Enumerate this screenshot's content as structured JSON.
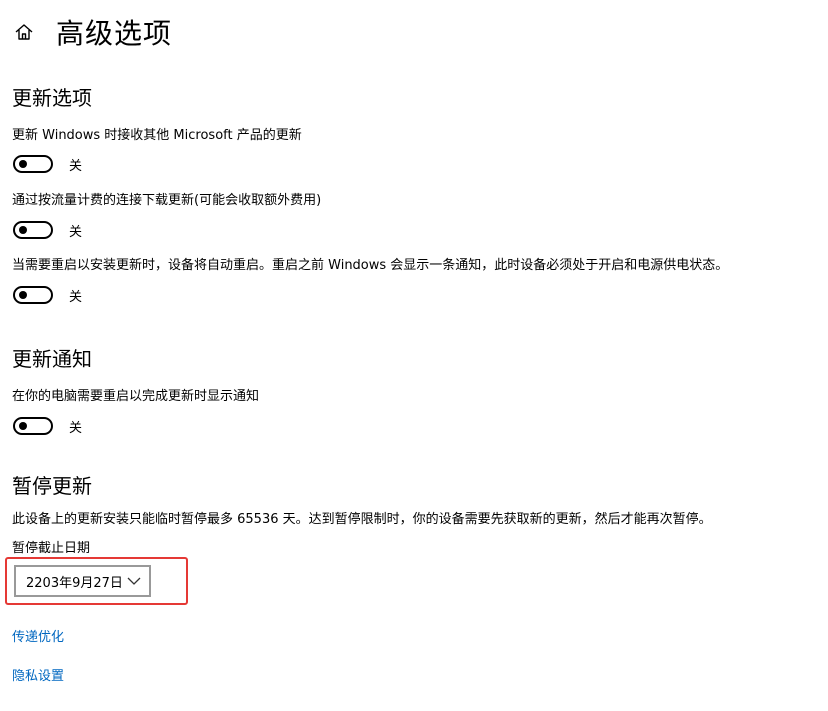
{
  "header": {
    "title": "高级选项"
  },
  "update_options": {
    "title": "更新选项",
    "items": [
      {
        "label": "更新 Windows 时接收其他 Microsoft 产品的更新",
        "state": "关"
      },
      {
        "label": "通过按流量计费的连接下载更新(可能会收取额外费用)",
        "state": "关"
      },
      {
        "label": "当需要重启以安装更新时，设备将自动重启。重启之前 Windows 会显示一条通知，此时设备必须处于开启和电源供电状态。",
        "state": "关"
      }
    ]
  },
  "update_notifications": {
    "title": "更新通知",
    "items": [
      {
        "label": "在你的电脑需要重启以完成更新时显示通知",
        "state": "关"
      }
    ]
  },
  "pause_updates": {
    "title": "暂停更新",
    "description": "此设备上的更新安装只能临时暂停最多 65536 天。达到暂停限制时，你的设备需要先获取新的更新，然后才能再次暂停。",
    "date_label": "暂停截止日期",
    "date_value": "2203年9月27日"
  },
  "links": {
    "delivery_optimization": "传递优化",
    "privacy_settings": "隐私设置"
  },
  "colors": {
    "link": "#0067c0",
    "highlight": "#e53935"
  }
}
